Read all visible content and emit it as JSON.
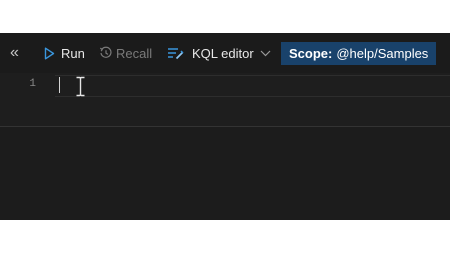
{
  "toolbar": {
    "run_label": "Run",
    "recall_label": "Recall",
    "editor_mode_label": "KQL editor",
    "scope_prefix": "Scope:",
    "scope_value": "@help/Samples"
  },
  "editor": {
    "line_numbers": [
      "1"
    ],
    "content": ""
  },
  "colors": {
    "accent_scope": "#19426b",
    "run_icon": "#3a96dd",
    "editor_bg": "#1e1e1e"
  }
}
